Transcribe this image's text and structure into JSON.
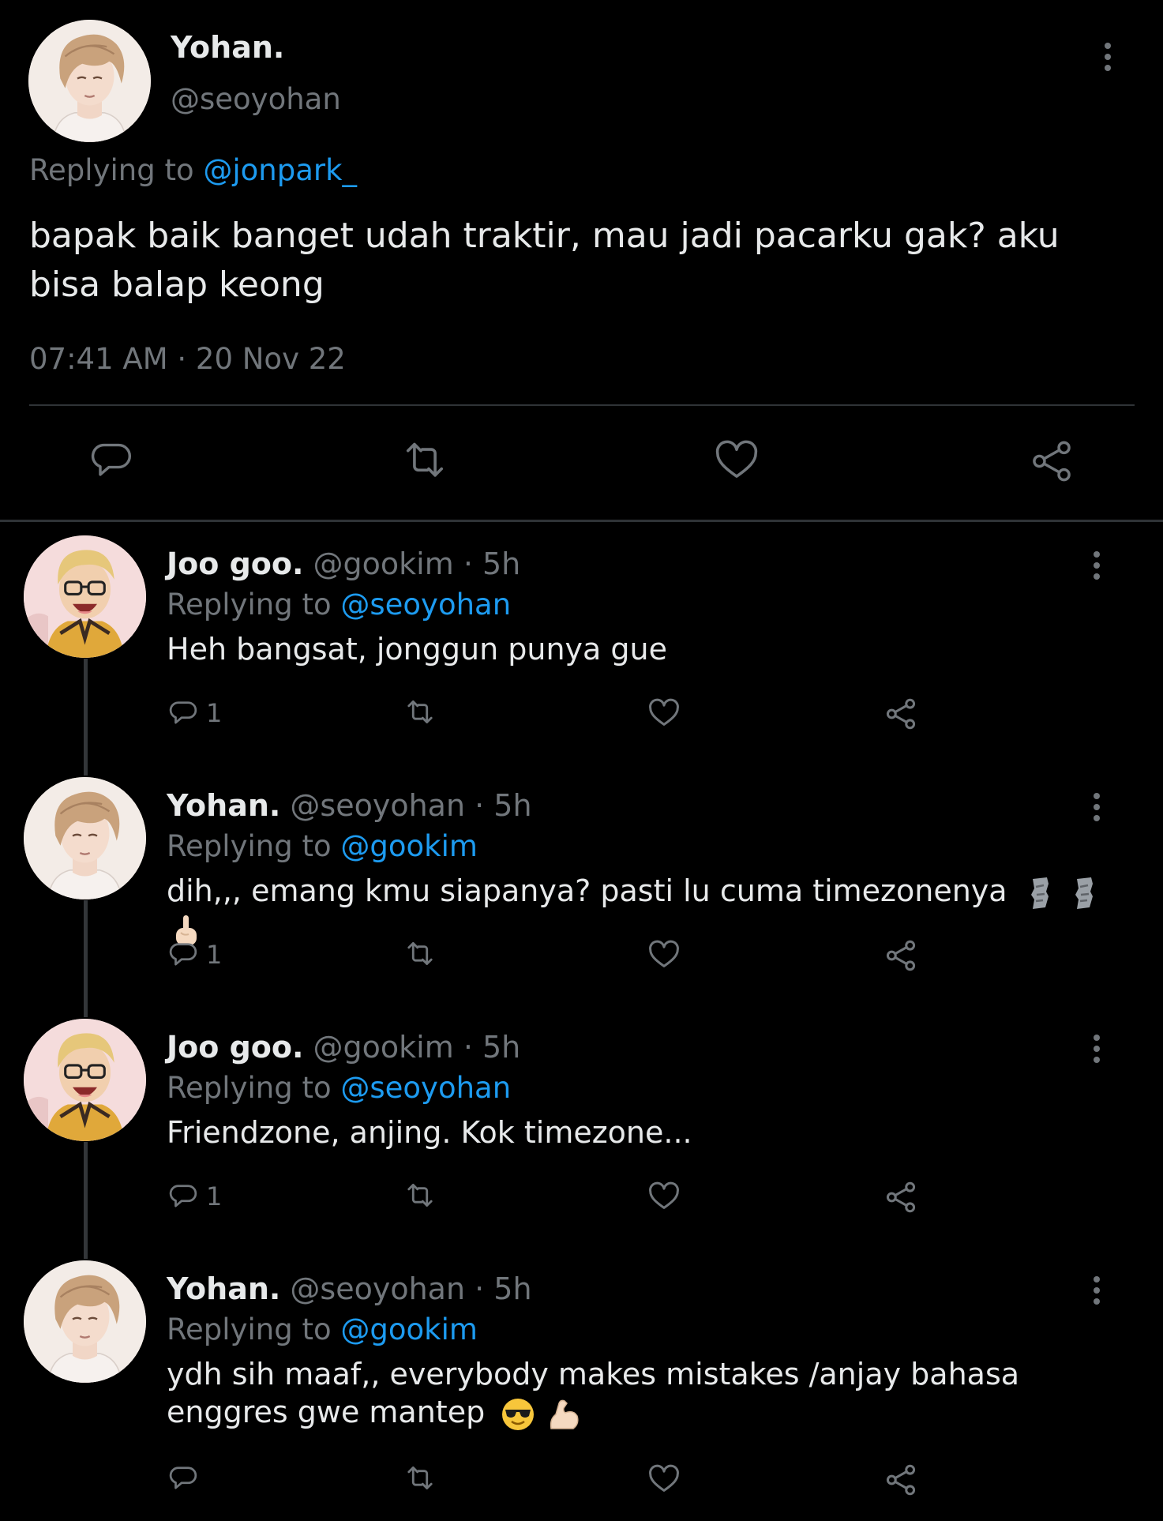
{
  "main_tweet": {
    "name": "Yohan.",
    "handle": "@seoyohan",
    "replying_prefix": "Replying to",
    "replying_to": "@jonpark_",
    "text": "bapak baik banget udah traktir, mau jadi pacarku gak? aku bisa balap keong",
    "timestamp": "07:41 AM · 20 Nov 22"
  },
  "replies": [
    {
      "name": "Joo goo.",
      "handle": "@gookim",
      "time": "· 5h",
      "replying_prefix": "Replying to",
      "replying_to": "@seoyohan",
      "text": "Heh bangsat, jonggun punya gue",
      "reply_count": "1"
    },
    {
      "name": "Yohan.",
      "handle": "@seoyohan",
      "time": "· 5h",
      "replying_prefix": "Replying to",
      "replying_to": "@gookim",
      "text": "dih,,, emang kmu siapanya? pasti lu cuma timezonenya",
      "emojis": [
        "moai",
        "moai",
        "pointing-up"
      ],
      "reply_count": "1"
    },
    {
      "name": "Joo goo.",
      "handle": "@gookim",
      "time": "· 5h",
      "replying_prefix": "Replying to",
      "replying_to": "@seoyohan",
      "text": "Friendzone, anjing. Kok timezone...",
      "reply_count": "1"
    },
    {
      "name": "Yohan.",
      "handle": "@seoyohan",
      "time": "· 5h",
      "replying_prefix": "Replying to",
      "replying_to": "@gookim",
      "text_line1": "ydh sih maaf,, everybody makes mistakes /anjay bahasa",
      "text_line2": "enggres gwe mantep",
      "emojis": [
        "sunglasses-face",
        "flexed-biceps"
      ],
      "reply_count": ""
    }
  ],
  "colors": {
    "background": "#000000",
    "text": "#e7e9ea",
    "muted": "#71767b",
    "link": "#1d9bf0",
    "divider": "#2f3336"
  },
  "icons": [
    "reply-icon",
    "retweet-icon",
    "like-icon",
    "share-icon",
    "more-icon"
  ]
}
